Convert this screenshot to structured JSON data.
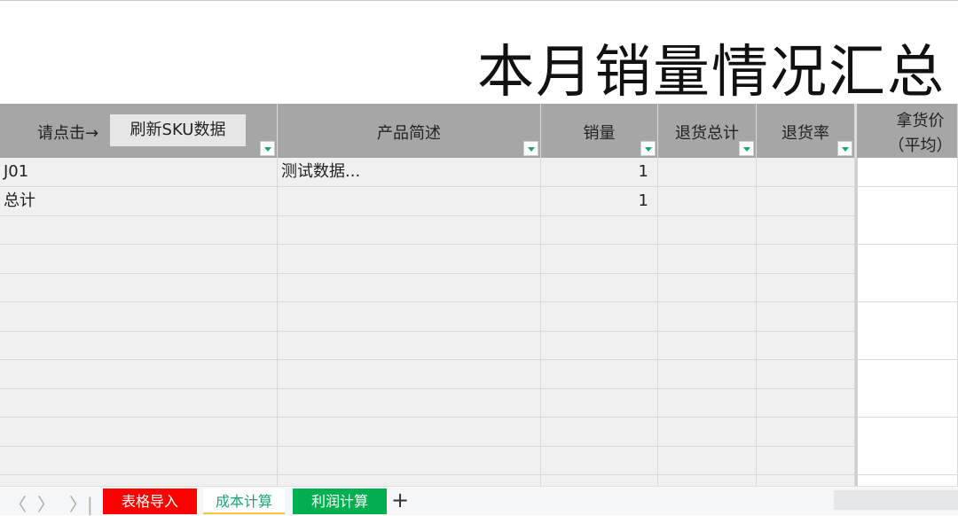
{
  "title": "本月销量情况汇总",
  "header": {
    "prompt": "请点击→",
    "refresh_button": "刷新SKU数据",
    "cols": [
      "产品简述",
      "销量",
      "退货总计",
      "退货率",
      "拿货价",
      "（平均）"
    ]
  },
  "rows": [
    {
      "sku": "J01",
      "desc": "测试数据...",
      "qty": "1"
    },
    {
      "sku": "总计",
      "desc": "",
      "qty": "1"
    }
  ],
  "tabs": [
    {
      "label": "表格导入",
      "color": "#ff0000"
    },
    {
      "label": "成本计算",
      "color": "#ffffff"
    },
    {
      "label": "利润计算",
      "color": "#00b050"
    }
  ],
  "add_tab": "+"
}
